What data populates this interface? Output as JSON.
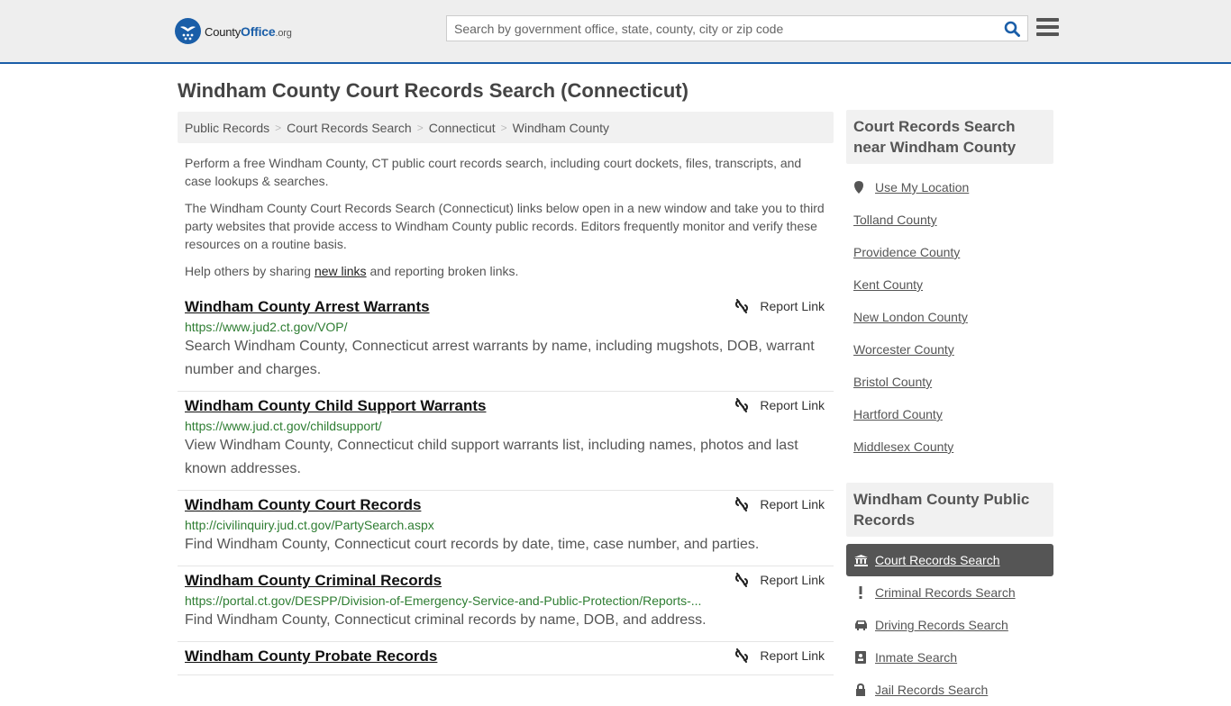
{
  "header": {
    "logo_main": "County",
    "logo_brand": "Office",
    "logo_tld": ".org",
    "search_placeholder": "Search by government office, state, county, city or zip code",
    "search_value": ""
  },
  "page_title": "Windham County Court Records Search (Connecticut)",
  "breadcrumb": [
    "Public Records",
    "Court Records Search",
    "Connecticut",
    "Windham County"
  ],
  "intro": {
    "p1": "Perform a free Windham County, CT public court records search, including court dockets, files, transcripts, and case lookups & searches.",
    "p2": "The Windham County Court Records Search (Connecticut) links below open in a new window and take you to third party websites that provide access to Windham County public records. Editors frequently monitor and verify these resources on a routine basis.",
    "p3_before": "Help others by sharing ",
    "p3_link": "new links",
    "p3_after": " and reporting broken links."
  },
  "report_label": "Report Link",
  "results": [
    {
      "title": "Windham County Arrest Warrants",
      "url": "https://www.jud2.ct.gov/VOP/",
      "desc": "Search Windham County, Connecticut arrest warrants by name, including mugshots, DOB, warrant number and charges."
    },
    {
      "title": "Windham County Child Support Warrants",
      "url": "https://www.jud.ct.gov/childsupport/",
      "desc": "View Windham County, Connecticut child support warrants list, including names, photos and last known addresses."
    },
    {
      "title": "Windham County Court Records",
      "url": "http://civilinquiry.jud.ct.gov/PartySearch.aspx",
      "desc": "Find Windham County, Connecticut court records by date, time, case number, and parties."
    },
    {
      "title": "Windham County Criminal Records",
      "url": "https://portal.ct.gov/DESPP/Division-of-Emergency-Service-and-Public-Protection/Reports-...",
      "desc": "Find Windham County, Connecticut criminal records by name, DOB, and address."
    },
    {
      "title": "Windham County Probate Records",
      "url": "",
      "desc": ""
    }
  ],
  "sidebar": {
    "near_heading": "Court Records Search near Windham County",
    "use_location": "Use My Location",
    "near": [
      "Tolland County",
      "Providence County",
      "Kent County",
      "New London County",
      "Worcester County",
      "Bristol County",
      "Hartford County",
      "Middlesex County"
    ],
    "public_heading": "Windham County Public Records",
    "public": [
      {
        "label": "Court Records Search",
        "icon": "courthouse-icon",
        "active": true
      },
      {
        "label": "Criminal Records Search",
        "icon": "exclamation-icon",
        "active": false
      },
      {
        "label": "Driving Records Search",
        "icon": "car-icon",
        "active": false
      },
      {
        "label": "Inmate Search",
        "icon": "id-card-icon",
        "active": false
      },
      {
        "label": "Jail Records Search",
        "icon": "lock-icon",
        "active": false
      }
    ]
  }
}
